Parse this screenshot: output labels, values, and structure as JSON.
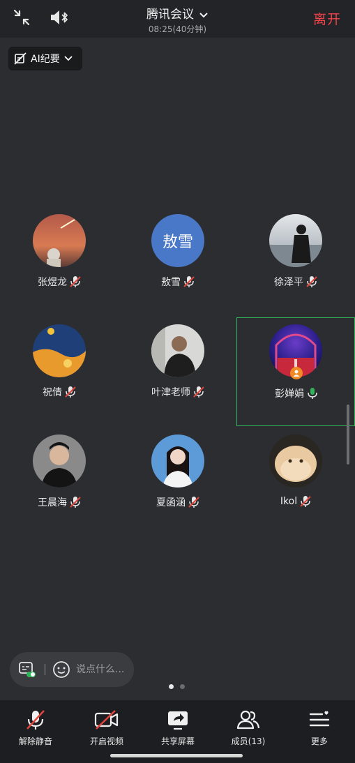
{
  "header": {
    "title": "腾讯会议",
    "subtitle": "08:25(40分钟)",
    "leave_label": "离开"
  },
  "ai_summary": {
    "label": "AI纪要"
  },
  "participants": [
    {
      "name": "张煜龙",
      "mic": "muted",
      "avatar_text": ""
    },
    {
      "name": "敖雪",
      "mic": "muted",
      "avatar_text": "敖雪",
      "avatar_color": "#4a78c8"
    },
    {
      "name": "徐泽平",
      "mic": "muted",
      "avatar_text": ""
    },
    {
      "name": "祝倩",
      "mic": "muted",
      "avatar_text": ""
    },
    {
      "name": "叶津老师",
      "mic": "muted",
      "avatar_text": ""
    },
    {
      "name": "彭婵娟",
      "mic": "on",
      "avatar_text": "",
      "host": true,
      "active_speaker": true
    },
    {
      "name": "王晨海",
      "mic": "muted",
      "avatar_text": ""
    },
    {
      "name": "夏函涵",
      "mic": "muted",
      "avatar_text": ""
    },
    {
      "name": "Ikol",
      "mic": "muted",
      "avatar_text": ""
    }
  ],
  "chat": {
    "placeholder": "说点什么..."
  },
  "pager": {
    "pages": 2,
    "current": 1
  },
  "toolbar": {
    "unmute": "解除静音",
    "start_video": "开启视频",
    "share_screen": "共享屏幕",
    "members": "成员(13)",
    "more": "更多"
  },
  "colors": {
    "leave": "#f0444b",
    "active_border": "#2fb45a",
    "mic_on": "#2fb45a",
    "mic_muted_slash": "#e0453d"
  }
}
